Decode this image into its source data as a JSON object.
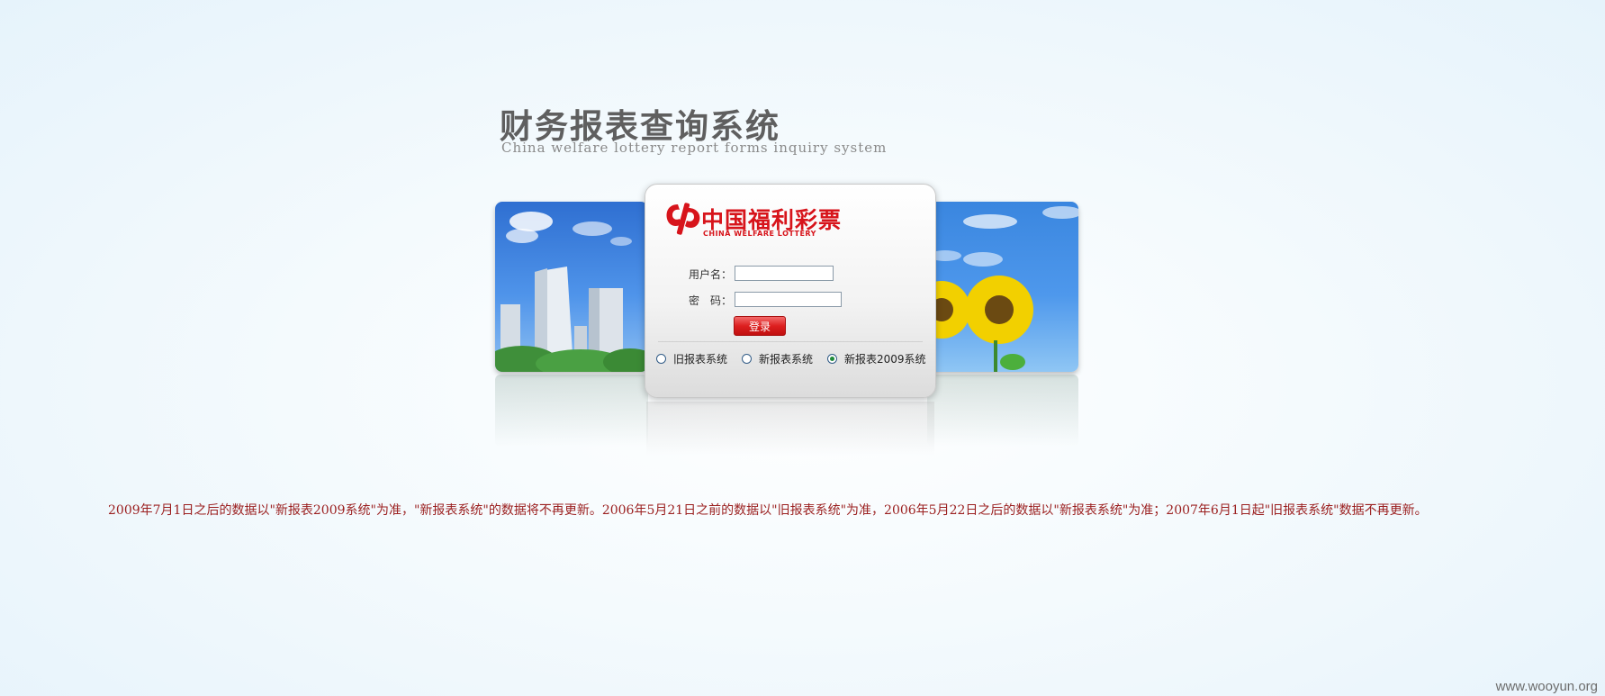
{
  "page": {
    "title_cn": "财务报表查询系统",
    "title_en": "China welfare lottery report forms inquiry system"
  },
  "logo": {
    "cn": "中国福利彩票",
    "en": "CHINA WELFARE LOTTERY",
    "color": "#d7141b"
  },
  "login": {
    "username_label": "用户名：",
    "username_value": "",
    "password_label": "密　码：",
    "password_value": "",
    "submit_label": "登录"
  },
  "systems": {
    "options": [
      {
        "label": "旧报表系统",
        "checked": false
      },
      {
        "label": "新报表系统",
        "checked": false
      },
      {
        "label": "新报表2009系统",
        "checked": true
      }
    ]
  },
  "notice": {
    "text": "2009年7月1日之后的数据以\"新报表2009系统\"为准，\"新报表系统\"的数据将不再更新。2006年5月21日之前的数据以\"旧报表系统\"为准，2006年5月22日之后的数据以\"新报表系统\"为准；2007年6月1日起\"旧报表系统\"数据不再更新。",
    "color": "#9b2020"
  },
  "watermark": "www.wooyun.org"
}
